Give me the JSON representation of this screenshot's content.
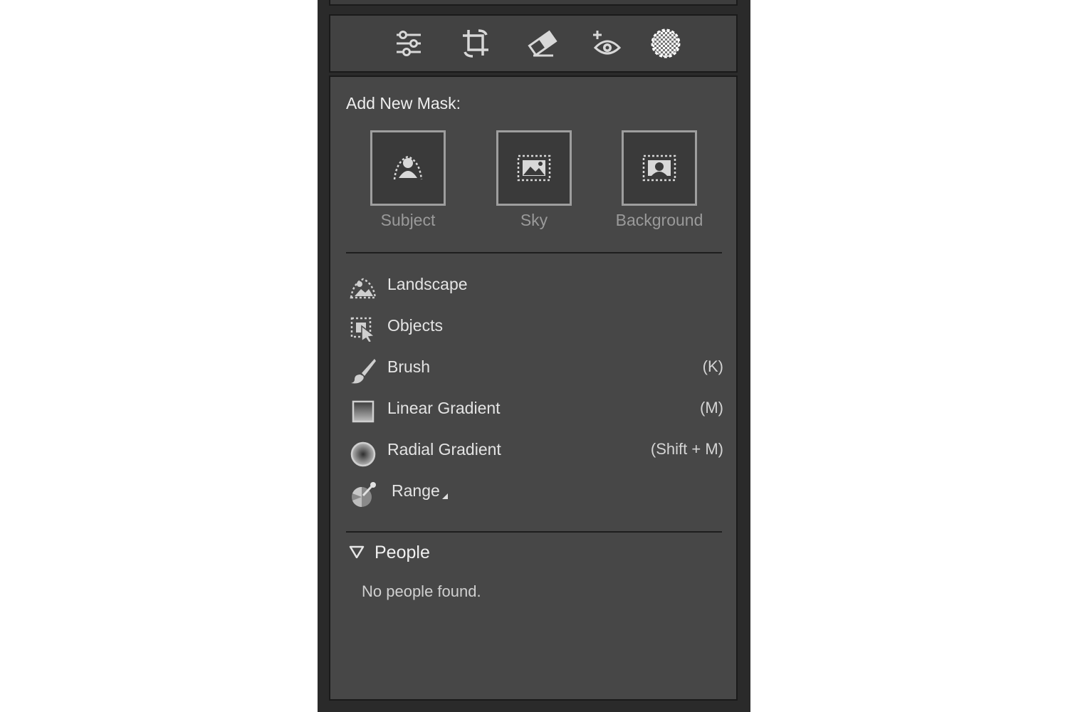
{
  "toolbar": {
    "tools": [
      {
        "icon": "edit-sliders-icon"
      },
      {
        "icon": "crop-icon"
      },
      {
        "icon": "eraser-icon"
      },
      {
        "icon": "red-eye-icon"
      },
      {
        "icon": "masking-icon"
      }
    ]
  },
  "mask_panel": {
    "heading": "Add New Mask:",
    "quick_masks": [
      {
        "label": "Subject",
        "icon": "subject-icon"
      },
      {
        "label": "Sky",
        "icon": "sky-icon"
      },
      {
        "label": "Background",
        "icon": "background-icon"
      }
    ],
    "tools": [
      {
        "label": "Landscape",
        "shortcut": "",
        "icon": "landscape-icon"
      },
      {
        "label": "Objects",
        "shortcut": "",
        "icon": "objects-icon"
      },
      {
        "label": "Brush",
        "shortcut": "(K)",
        "icon": "brush-icon"
      },
      {
        "label": "Linear Gradient",
        "shortcut": "(M)",
        "icon": "linear-gradient-icon"
      },
      {
        "label": "Radial Gradient",
        "shortcut": "(Shift + M)",
        "icon": "radial-gradient-icon"
      },
      {
        "label": "Range",
        "shortcut": "",
        "icon": "range-icon"
      }
    ]
  },
  "people": {
    "title": "People",
    "empty_text": "No people found."
  }
}
